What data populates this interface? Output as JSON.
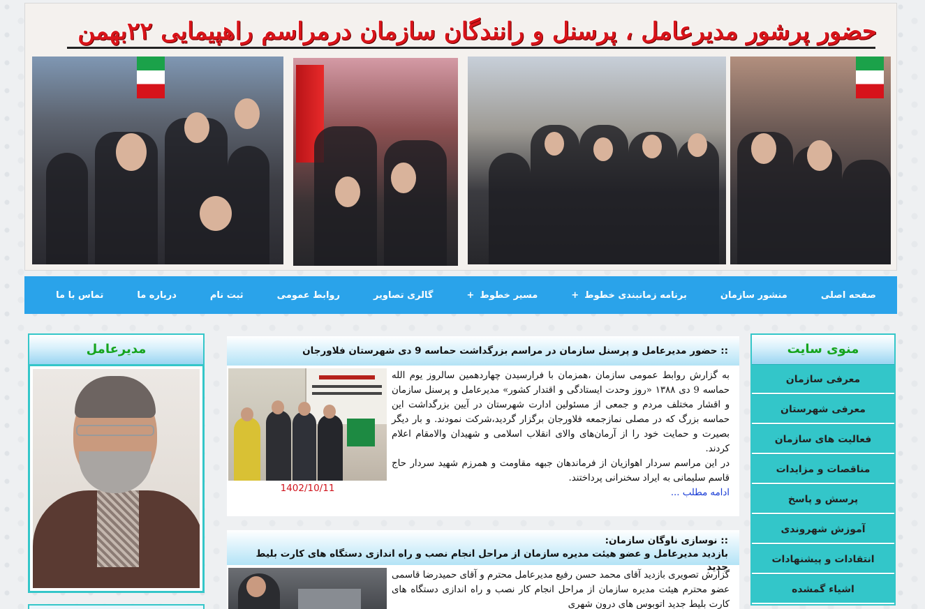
{
  "banner": {
    "title": "حضور پرشور مدیرعامل ، پرسنل و رانندگان سازمان درمراسم راهپیمایی ۲۲بهمن"
  },
  "nav": {
    "items": [
      {
        "label": "صفحه اصلی",
        "has_sub": false
      },
      {
        "label": "منشور سازمان",
        "has_sub": false
      },
      {
        "label": "برنامه زمانبندی خطوط",
        "has_sub": true
      },
      {
        "label": "مسیر خطوط",
        "has_sub": true
      },
      {
        "label": "گالری تصاویر",
        "has_sub": false
      },
      {
        "label": "روابط عمومی",
        "has_sub": false
      },
      {
        "label": "ثبت نام",
        "has_sub": false
      },
      {
        "label": "درباره ما",
        "has_sub": false
      },
      {
        "label": "تماس با ما",
        "has_sub": false
      }
    ],
    "plus_symbol": "+"
  },
  "left_box": {
    "title": "مدیرعامل"
  },
  "right_box": {
    "title": "منوی سایت",
    "items": [
      "معرفی سازمان",
      "معرفی شهرستان",
      "فعالیت های سازمان",
      "مناقصات و مزایدات",
      "پرسش و پاسخ",
      "آموزش شهروندی",
      "انتقادات و پیشنهادات",
      "اشیاء گمشده"
    ]
  },
  "posts": [
    {
      "title": ":: حضور مدیرعامل و پرسنل سازمان در مراسم بزرگداشت حماسه 9 دی شهرستان فلاورجان",
      "body": "به گزارش روابط عمومی سازمان ،همزمان با فرارسیدن چهاردهمین سالروز یوم الله حماسه 9 دی ۱۳۸۸ «روز وحدت ایستادگی و اقتدار کشور» مدیرعامل و پرسنل سازمان و اقشار مختلف مردم و جمعی از مسئولین ادارت شهرستان در آیین بزرگداشت این حماسه بزرگ که در مصلی نمازجمعه فلاورجان برگزار گردید،شرکت نمودند. و بار دیگر بصیرت و حمایت خود را از آرمان‌های والای انقلاب اسلامی و شهیدان والامقام اعلام کردند.",
      "body2": "در این مراسم سردار اهوازیان از فرماندهان جبهه مقاومت و همرزم شهید سردار حاج قاسم سلیمانی به ایراد سخنرانی پرداختند.",
      "read_more": "ادامه مطلب ...",
      "date": "1402/10/11"
    },
    {
      "title_line1": ":: نوسازی ناوگان سازمان:",
      "title_line2": "بازدید مدیرعامل و عضو هیئت مدیره سازمان از مراحل انجام نصب و راه اندازی دستگاه های کارت بلیط جدید",
      "body": "گزارش تصویری بازدید آقای محمد حسن رفیع مدیرعامل محترم و آقای حمیدرضا قاسمی عضو محترم هیئت مدیره سازمان از مراحل انجام کار نصب و راه اندازی دستگاه های کارت بلیط جدید اتوبوس های درون شهری"
    }
  ],
  "colors": {
    "nav_bg": "#2aa3ea",
    "box_border": "#34c6c9",
    "menu_bg": "#33c6c9",
    "title_green": "#16a41d",
    "date_red": "#d0141d",
    "link_blue": "#1a3dd6"
  }
}
